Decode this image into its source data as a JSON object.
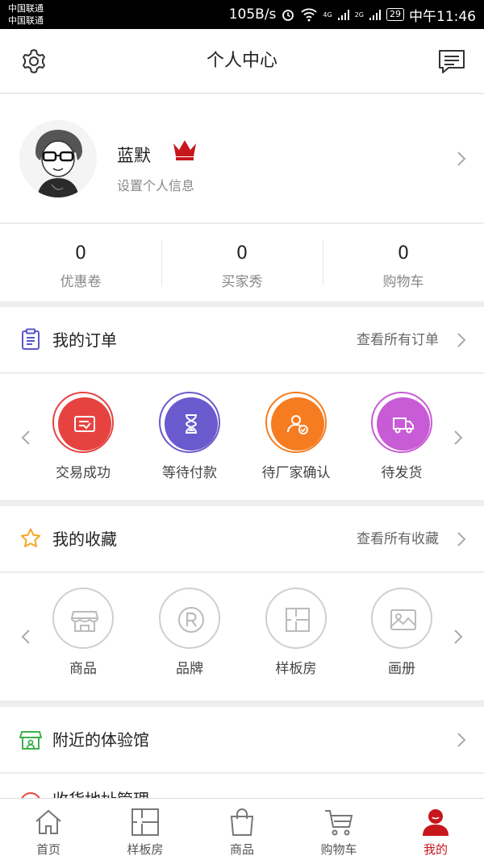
{
  "status_bar": {
    "carrier_1": "中国联通",
    "carrier_2": "中国联通",
    "speed": "105B/s",
    "net_1": "4G",
    "net_2": "2G",
    "battery": "29",
    "time": "中午11:46"
  },
  "header": {
    "title": "个人中心",
    "left_icon": "gear-icon",
    "right_icon": "message-icon"
  },
  "profile": {
    "name": "蓝默",
    "subtitle": "设置个人信息",
    "badge_icon": "crown-icon"
  },
  "stats": [
    {
      "value": "0",
      "label": "优惠卷"
    },
    {
      "value": "0",
      "label": "买家秀"
    },
    {
      "value": "0",
      "label": "购物车"
    }
  ],
  "orders": {
    "title": "我的订单",
    "link": "查看所有订单",
    "items": [
      {
        "label": "交易成功",
        "icon": "receipt-icon",
        "color": "#e64340"
      },
      {
        "label": "等待付款",
        "icon": "hourglass-icon",
        "color": "#6a5acd"
      },
      {
        "label": "待厂家确认",
        "icon": "user-check-icon",
        "color": "#f57c20"
      },
      {
        "label": "待发货",
        "icon": "truck-icon",
        "color": "#c85bd6"
      }
    ]
  },
  "favorites": {
    "title": "我的收藏",
    "link": "查看所有收藏",
    "items": [
      {
        "label": "商品",
        "icon": "store-icon"
      },
      {
        "label": "品牌",
        "icon": "registered-icon"
      },
      {
        "label": "样板房",
        "icon": "floorplan-icon"
      },
      {
        "label": "画册",
        "icon": "image-icon"
      }
    ]
  },
  "nearby": {
    "title": "附近的体验馆"
  },
  "address": {
    "title": "收货地址管理"
  },
  "tabbar": [
    {
      "label": "首页",
      "icon": "home-icon"
    },
    {
      "label": "样板房",
      "icon": "floorplan-icon"
    },
    {
      "label": "商品",
      "icon": "bag-icon"
    },
    {
      "label": "购物车",
      "icon": "cart-icon"
    },
    {
      "label": "我的",
      "icon": "user-icon",
      "active": true
    }
  ],
  "colors": {
    "accent": "#c8161d"
  }
}
